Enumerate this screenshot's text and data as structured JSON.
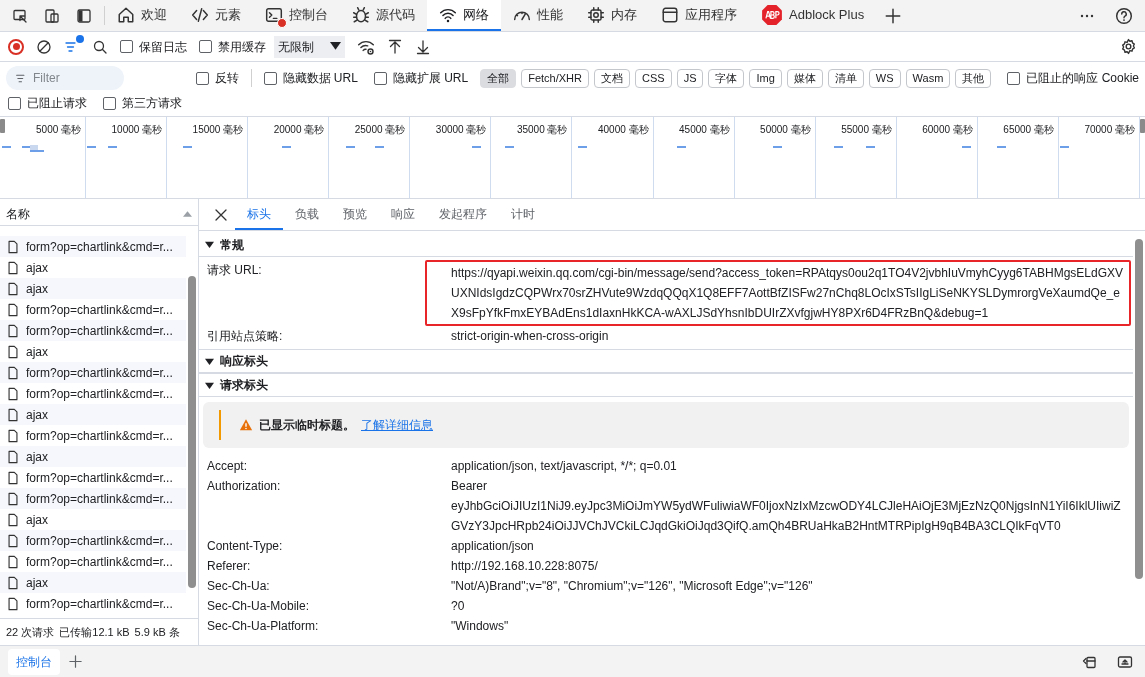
{
  "devtools_tabs": [
    {
      "label": "欢迎",
      "selected": false
    },
    {
      "label": "元素",
      "selected": false
    },
    {
      "label": "控制台",
      "selected": false,
      "error_badge": true
    },
    {
      "label": "源代码",
      "selected": false
    },
    {
      "label": "网络",
      "selected": true
    },
    {
      "label": "性能",
      "selected": false
    },
    {
      "label": "内存",
      "selected": false
    },
    {
      "label": "应用程序",
      "selected": false
    },
    {
      "label": "Adblock Plus",
      "selected": false
    }
  ],
  "toolbar": {
    "recording": true,
    "filter_active": true,
    "preserve_log": {
      "label": "保留日志",
      "checked": false
    },
    "disable_cache": {
      "label": "禁用缓存",
      "checked": false
    },
    "throttling": "无限制"
  },
  "filter_bar": {
    "placeholder": "Filter",
    "invert": {
      "label": "反转",
      "checked": false
    },
    "hide_data_urls": {
      "label": "隐藏数据 URL",
      "checked": false
    },
    "hide_extension_urls": {
      "label": "隐藏扩展 URL",
      "checked": false
    },
    "types": [
      {
        "label": "全部",
        "selected": true
      },
      {
        "label": "Fetch/XHR",
        "selected": false
      },
      {
        "label": "文档",
        "selected": false
      },
      {
        "label": "CSS",
        "selected": false
      },
      {
        "label": "JS",
        "selected": false
      },
      {
        "label": "字体",
        "selected": false
      },
      {
        "label": "Img",
        "selected": false
      },
      {
        "label": "媒体",
        "selected": false
      },
      {
        "label": "清单",
        "selected": false
      },
      {
        "label": "WS",
        "selected": false
      },
      {
        "label": "Wasm",
        "selected": false
      },
      {
        "label": "其他",
        "selected": false
      }
    ],
    "blocked_response_cookies": {
      "label": "已阻止的响应 Cookie",
      "checked": false
    },
    "blocked_requests": {
      "label": "已阻止请求",
      "checked": false
    },
    "third_party_requests": {
      "label": "第三方请求",
      "checked": false
    }
  },
  "overview": {
    "ticks": [
      "5000 毫秒",
      "10000 毫秒",
      "15000 毫秒",
      "20000 毫秒",
      "25000 毫秒",
      "30000 毫秒",
      "35000 毫秒",
      "40000 毫秒",
      "45000 毫秒",
      "50000 毫秒",
      "55000 毫秒",
      "60000 毫秒",
      "65000 毫秒",
      "70000 毫秒"
    ]
  },
  "requests": {
    "header": "名称",
    "rows": [
      {
        "name": "form?op=chartlink&cmd=r..."
      },
      {
        "name": "ajax"
      },
      {
        "name": "ajax"
      },
      {
        "name": "form?op=chartlink&cmd=r..."
      },
      {
        "name": "form?op=chartlink&cmd=r..."
      },
      {
        "name": "ajax"
      },
      {
        "name": "form?op=chartlink&cmd=r..."
      },
      {
        "name": "form?op=chartlink&cmd=r..."
      },
      {
        "name": "ajax"
      },
      {
        "name": "form?op=chartlink&cmd=r..."
      },
      {
        "name": "ajax"
      },
      {
        "name": "form?op=chartlink&cmd=r..."
      },
      {
        "name": "form?op=chartlink&cmd=r..."
      },
      {
        "name": "ajax"
      },
      {
        "name": "form?op=chartlink&cmd=r..."
      },
      {
        "name": "form?op=chartlink&cmd=r..."
      },
      {
        "name": "ajax"
      },
      {
        "name": "form?op=chartlink&cmd=r..."
      }
    ]
  },
  "status_bar": [
    "22 次请求",
    "已传输12.1 kB",
    "5.9 kB 条"
  ],
  "detail_tabs": [
    {
      "label": "标头",
      "selected": true
    },
    {
      "label": "负载",
      "selected": false
    },
    {
      "label": "预览",
      "selected": false
    },
    {
      "label": "响应",
      "selected": false
    },
    {
      "label": "发起程序",
      "selected": false
    },
    {
      "label": "计时",
      "selected": false
    }
  ],
  "sections": [
    {
      "title": "常规",
      "expanded": true,
      "rows": [
        {
          "label": "请求 URL:",
          "value": "https://qyapi.weixin.qq.com/cgi-bin/message/send?access_token=RPAtqys0ou2q1TO4V2jvbhIuVmyhCyyg6TABHMgsELdGXVUXNIdsIgdzCQPWrx70srZHVute9WzdqQQqX1Q8EFF7AottBfZISFw27nChq8LOcIxSTsIIgLiSeNKYSLDymrorgVeXaumdQe_eX9sFpYfkFmxEYBAdEns1dIaxnHkKCA-wAXLJSdYhsnIbDUIrZXvfgjwHY8PXr6D4FRzBnQ&debug=1",
          "highlighted": true
        },
        {
          "label": "引用站点策略:",
          "value": "strict-origin-when-cross-origin",
          "highlighted": false
        }
      ]
    },
    {
      "title": "响应标头",
      "expanded": true
    },
    {
      "title": "请求标头",
      "expanded": true,
      "notice": {
        "text": "已显示临时标题。",
        "link": "了解详细信息"
      },
      "rows": [
        {
          "label": "Accept:",
          "value": "application/json, text/javascript, */*; q=0.01",
          "highlighted": false
        },
        {
          "label": "Authorization:",
          "value": "Bearer eyJhbGciOiJIUzI1NiJ9.eyJpc3MiOiJmYW5ydWFuliwiaWF0IjoxNzIxMzcwODY4LCJleHAiOjE3MjEzNzQ0NjgsInN1YiI6IklUIiwiZGVzY3JpcHRpb24iOiJJVChJVCkiLCJqdGkiOiJqd3QifQ.amQh4BRUaHkaB2HntMTRPipIgH9qB4BA3CLQIkFqVT0",
          "highlighted": false
        },
        {
          "label": "Content-Type:",
          "value": "application/json",
          "highlighted": false
        },
        {
          "label": "Referer:",
          "value": "http://192.168.10.228:8075/",
          "highlighted": false
        },
        {
          "label": "Sec-Ch-Ua:",
          "value": "\"Not/A)Brand\";v=\"8\", \"Chromium\";v=\"126\", \"Microsoft Edge\";v=\"126\"",
          "highlighted": false
        },
        {
          "label": "Sec-Ch-Ua-Mobile:",
          "value": "?0",
          "highlighted": false
        },
        {
          "label": "Sec-Ch-Ua-Platform:",
          "value": "\"Windows\"",
          "highlighted": false
        }
      ]
    }
  ],
  "drawer": {
    "tabs": [
      {
        "label": "控制台",
        "selected": true
      }
    ]
  }
}
